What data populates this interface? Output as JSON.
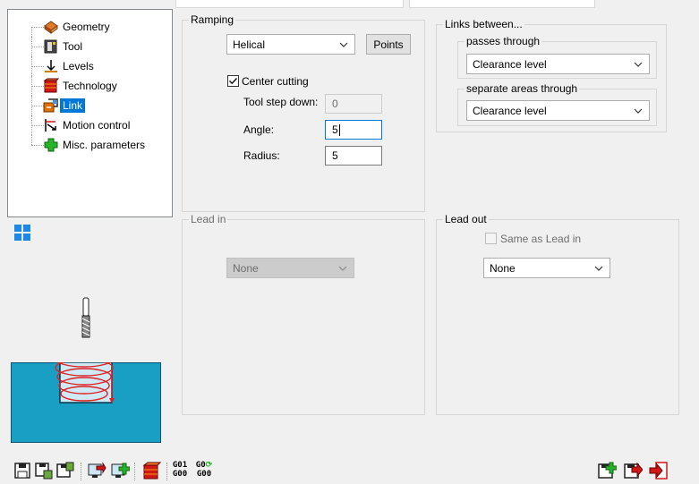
{
  "tree": {
    "items": [
      {
        "label": "Geometry",
        "icon": "geometry-icon"
      },
      {
        "label": "Tool",
        "icon": "tool-icon"
      },
      {
        "label": "Levels",
        "icon": "levels-icon"
      },
      {
        "label": "Technology",
        "icon": "technology-icon"
      },
      {
        "label": "Link",
        "icon": "link-icon",
        "selected": true
      },
      {
        "label": "Motion control",
        "icon": "motion-control-icon"
      },
      {
        "label": "Misc. parameters",
        "icon": "misc-parameters-icon"
      }
    ]
  },
  "ramping": {
    "title": "Ramping",
    "mode": "Helical",
    "points_label": "Points",
    "center_cutting_label": "Center cutting",
    "center_cutting_checked": true,
    "tool_step_down_label": "Tool step down:",
    "tool_step_down_value": "0",
    "angle_label": "Angle:",
    "angle_value": "5",
    "radius_label": "Radius:",
    "radius_value": "5"
  },
  "links": {
    "title": "Links between...",
    "passes_title": "passes through",
    "passes_value": "Clearance level",
    "areas_title": "separate areas through",
    "areas_value": "Clearance level"
  },
  "lead_in": {
    "title": "Lead in",
    "value": "None"
  },
  "lead_out": {
    "title": "Lead out",
    "same_as_label": "Same as Lead in",
    "same_as_checked": false,
    "value": "None"
  },
  "toolbar": {
    "gcode1_top": "G01",
    "gcode1_bottom": "G00",
    "gcode2_top": "G0",
    "gcode2_bottom": "G00"
  },
  "colors": {
    "selection": "#0078d7",
    "helix": "#e02020",
    "part": "#1a9fc4",
    "pocket": "#cfe9f7"
  }
}
